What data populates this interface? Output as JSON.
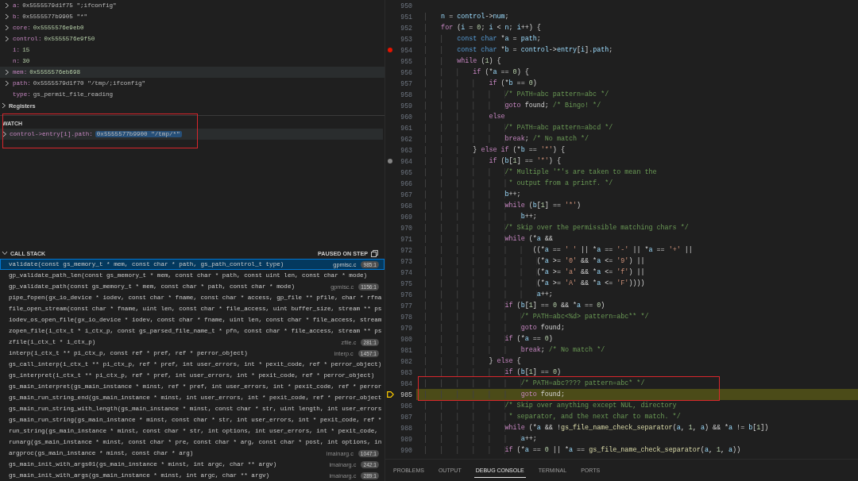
{
  "variables": [
    {
      "label": "a:",
      "value": "0x5555579d1f75 \";ifconfig\"",
      "kind": "text",
      "expandable": true,
      "selected": false
    },
    {
      "label": "b:",
      "value": "0x5555577b9905 \"*\"",
      "kind": "text",
      "expandable": true,
      "selected": false
    },
    {
      "label": "core:",
      "value": "0x5555576e9eb0",
      "kind": "number",
      "expandable": true,
      "selected": false
    },
    {
      "label": "control:",
      "value": "0x5555576e9f50",
      "kind": "number",
      "expandable": true,
      "selected": false
    },
    {
      "label": "i:",
      "value": "15",
      "kind": "number",
      "expandable": false,
      "selected": false
    },
    {
      "label": "n:",
      "value": "30",
      "kind": "number",
      "expandable": false,
      "selected": false
    },
    {
      "label": "mem:",
      "value": "0x5555576eb698",
      "kind": "number",
      "expandable": true,
      "selected": true
    },
    {
      "label": "path:",
      "value": "0x5555579d1f70 \"/tmp/;ifconfig\"",
      "kind": "text",
      "expandable": true,
      "selected": false
    },
    {
      "label": "type:",
      "value": "gs_permit_file_reading",
      "kind": "text",
      "expandable": false,
      "selected": false
    }
  ],
  "registers": {
    "label": "Registers",
    "expanded": false
  },
  "watch": {
    "title": "WATCH",
    "items": [
      {
        "expression": "control->entry[i].path:",
        "value": "0x5555577b9900 \"/tmp/*\"",
        "selected": true
      }
    ]
  },
  "call_stack": {
    "title": "CALL STACK",
    "status": "PAUSED ON STEP",
    "frames": [
      {
        "function": "validate(const gs_memory_t * mem, const char * path, gs_path_control_t type)",
        "file": "gpmisc.c",
        "position": "985:1",
        "selected": true
      },
      {
        "function": "gp_validate_path_len(const gs_memory_t * mem, const char * path, const uint len, const char * mode)",
        "selected": false
      },
      {
        "function": "gp_validate_path(const gs_memory_t * mem, const char * path, const char * mode)",
        "file": "gpmisc.c",
        "position": "1156:1",
        "selected": false
      },
      {
        "function": "pipe_fopen(gx_io_device * iodev, const char * fname, const char * access, gp_file ** pfile, char * rfna",
        "selected": false
      },
      {
        "function": "file_open_stream(const char * fname, uint len, const char * file_access, uint buffer_size, stream ** ps",
        "selected": false
      },
      {
        "function": "iodev_os_open_file(gx_io_device * iodev, const char * fname, uint len, const char * file_access, stream",
        "selected": false
      },
      {
        "function": "zopen_file(i_ctx_t * i_ctx_p, const gs_parsed_file_name_t * pfn, const char * file_access, stream ** ps",
        "selected": false
      },
      {
        "function": "zfile(i_ctx_t * i_ctx_p)",
        "file": "zfile.c",
        "position": "281:1",
        "selected": false
      },
      {
        "function": "interp(i_ctx_t ** pi_ctx_p, const ref * pref, ref * perror_object)",
        "file": "interp.c",
        "position": "1457:1",
        "selected": false
      },
      {
        "function": "gs_call_interp(i_ctx_t ** pi_ctx_p, ref * pref, int user_errors, int * pexit_code, ref * perror_object)",
        "selected": false
      },
      {
        "function": "gs_interpret(i_ctx_t ** pi_ctx_p, ref * pref, int user_errors, int * pexit_code, ref * perror_object)",
        "selected": false
      },
      {
        "function": "gs_main_interpret(gs_main_instance * minst, ref * pref, int user_errors, int * pexit_code, ref * perror",
        "selected": false
      },
      {
        "function": "gs_main_run_string_end(gs_main_instance * minst, int user_errors, int * pexit_code, ref * perror_object",
        "selected": false
      },
      {
        "function": "gs_main_run_string_with_length(gs_main_instance * minst, const char * str, uint length, int user_errors",
        "selected": false
      },
      {
        "function": "gs_main_run_string(gs_main_instance * minst, const char * str, int user_errors, int * pexit_code, ref *",
        "selected": false
      },
      {
        "function": "run_string(gs_main_instance * minst, const char * str, int options, int user_errors, int * pexit_code,",
        "selected": false
      },
      {
        "function": "runarg(gs_main_instance * minst, const char * pre, const char * arg, const char * post, int options, in",
        "selected": false
      },
      {
        "function": "argproc(gs_main_instance * minst, const char * arg)",
        "file": "imainarg.c",
        "position": "1047:1",
        "selected": false
      },
      {
        "function": "gs_main_init_with_args01(gs_main_instance * minst, int argc, char ** argv)",
        "file": "imainarg.c",
        "position": "242:1",
        "selected": false
      },
      {
        "function": "gs_main_init_with_args(gs_main_instance * minst, int argc, char ** argv)",
        "file": "imainarg.c",
        "position": "289:1",
        "selected": false
      }
    ]
  },
  "editor": {
    "lines": [
      {
        "number": "950",
        "breakpoint": false,
        "current": false
      },
      {
        "number": "951",
        "breakpoint": false,
        "current": false,
        "tokens": [
          {
            "kind": "variable",
            "text": "    n"
          },
          {
            "kind": "plain",
            "text": " = "
          },
          {
            "kind": "variable",
            "text": "control"
          },
          {
            "kind": "plain",
            "text": "->"
          },
          {
            "kind": "variable",
            "text": "num"
          },
          {
            "kind": "plain",
            "text": ";"
          }
        ]
      },
      {
        "number": "952",
        "breakpoint": false,
        "current": false,
        "tokens": [
          {
            "kind": "keyword",
            "text": "    for"
          },
          {
            "kind": "plain",
            "text": " ("
          },
          {
            "kind": "variable",
            "text": "i"
          },
          {
            "kind": "plain",
            "text": " = "
          },
          {
            "kind": "number",
            "text": "0"
          },
          {
            "kind": "plain",
            "text": "; "
          },
          {
            "kind": "variable",
            "text": "i"
          },
          {
            "kind": "plain",
            "text": " < "
          },
          {
            "kind": "variable",
            "text": "n"
          },
          {
            "kind": "plain",
            "text": "; "
          },
          {
            "kind": "variable",
            "text": "i"
          },
          {
            "kind": "plain",
            "text": "++) {"
          }
        ]
      },
      {
        "number": "953",
        "breakpoint": false,
        "current": false,
        "tokens": [
          {
            "kind": "type",
            "text": "        const char"
          },
          {
            "kind": "plain",
            "text": " *"
          },
          {
            "kind": "variable",
            "text": "a"
          },
          {
            "kind": "plain",
            "text": " = "
          },
          {
            "kind": "variable",
            "text": "path"
          },
          {
            "kind": "plain",
            "text": ";"
          }
        ]
      },
      {
        "number": "954",
        "breakpoint": true,
        "breakpoint_enabled": true,
        "current": false,
        "tokens": [
          {
            "kind": "type",
            "text": "        const char"
          },
          {
            "kind": "plain",
            "text": " *"
          },
          {
            "kind": "variable",
            "text": "b"
          },
          {
            "kind": "plain",
            "text": " = "
          },
          {
            "kind": "variable",
            "text": "control"
          },
          {
            "kind": "plain",
            "text": "->"
          },
          {
            "kind": "variable",
            "text": "entry"
          },
          {
            "kind": "plain",
            "text": "["
          },
          {
            "kind": "variable",
            "text": "i"
          },
          {
            "kind": "plain",
            "text": "]."
          },
          {
            "kind": "variable",
            "text": "path"
          },
          {
            "kind": "plain",
            "text": ";"
          }
        ]
      },
      {
        "number": "955",
        "breakpoint": false,
        "current": false,
        "tokens": [
          {
            "kind": "keyword",
            "text": "        while"
          },
          {
            "kind": "plain",
            "text": " ("
          },
          {
            "kind": "number",
            "text": "1"
          },
          {
            "kind": "plain",
            "text": ") {"
          }
        ]
      },
      {
        "number": "956",
        "breakpoint": false,
        "current": false,
        "tokens": [
          {
            "kind": "keyword",
            "text": "            if"
          },
          {
            "kind": "plain",
            "text": " (*"
          },
          {
            "kind": "variable",
            "text": "a"
          },
          {
            "kind": "plain",
            "text": " == "
          },
          {
            "kind": "number",
            "text": "0"
          },
          {
            "kind": "plain",
            "text": ") {"
          }
        ]
      },
      {
        "number": "957",
        "breakpoint": false,
        "current": false,
        "tokens": [
          {
            "kind": "keyword",
            "text": "                if"
          },
          {
            "kind": "plain",
            "text": " (*"
          },
          {
            "kind": "variable",
            "text": "b"
          },
          {
            "kind": "plain",
            "text": " == "
          },
          {
            "kind": "number",
            "text": "0"
          },
          {
            "kind": "plain",
            "text": ")"
          }
        ]
      },
      {
        "number": "958",
        "breakpoint": false,
        "current": false,
        "tokens": [
          {
            "kind": "comment",
            "text": "                    /* PATH=abc pattern=abc */"
          }
        ]
      },
      {
        "number": "959",
        "breakpoint": false,
        "current": false,
        "tokens": [
          {
            "kind": "keyword",
            "text": "                    goto"
          },
          {
            "kind": "plain",
            "text": " found; "
          },
          {
            "kind": "comment",
            "text": "/* Bingo! */"
          }
        ]
      },
      {
        "number": "960",
        "breakpoint": false,
        "current": false,
        "tokens": [
          {
            "kind": "keyword",
            "text": "                else"
          }
        ]
      },
      {
        "number": "961",
        "breakpoint": false,
        "current": false,
        "tokens": [
          {
            "kind": "comment",
            "text": "                    /* PATH=abc pattern=abcd */"
          }
        ]
      },
      {
        "number": "962",
        "breakpoint": false,
        "current": false,
        "tokens": [
          {
            "kind": "keyword",
            "text": "                    break"
          },
          {
            "kind": "plain",
            "text": "; "
          },
          {
            "kind": "comment",
            "text": "/* No match */"
          }
        ]
      },
      {
        "number": "963",
        "breakpoint": false,
        "current": false,
        "tokens": [
          {
            "kind": "plain",
            "text": "            } "
          },
          {
            "kind": "keyword",
            "text": "else if"
          },
          {
            "kind": "plain",
            "text": " (*"
          },
          {
            "kind": "variable",
            "text": "b"
          },
          {
            "kind": "plain",
            "text": " == "
          },
          {
            "kind": "string",
            "text": "'*'"
          },
          {
            "kind": "plain",
            "text": ") {"
          }
        ]
      },
      {
        "number": "964",
        "breakpoint": true,
        "breakpoint_enabled": false,
        "current": false,
        "tokens": [
          {
            "kind": "keyword",
            "text": "                if"
          },
          {
            "kind": "plain",
            "text": " ("
          },
          {
            "kind": "variable",
            "text": "b"
          },
          {
            "kind": "plain",
            "text": "["
          },
          {
            "kind": "number",
            "text": "1"
          },
          {
            "kind": "plain",
            "text": "] == "
          },
          {
            "kind": "string",
            "text": "'*'"
          },
          {
            "kind": "plain",
            "text": ") {"
          }
        ]
      },
      {
        "number": "965",
        "breakpoint": false,
        "current": false,
        "tokens": [
          {
            "kind": "comment",
            "text": "                    /* Multiple '*'s are taken to mean the"
          }
        ]
      },
      {
        "number": "966",
        "breakpoint": false,
        "current": false,
        "tokens": [
          {
            "kind": "comment",
            "text": "                     * output from a printf. */"
          }
        ]
      },
      {
        "number": "967",
        "breakpoint": false,
        "current": false,
        "tokens": [
          {
            "kind": "variable",
            "text": "                    b"
          },
          {
            "kind": "plain",
            "text": "++;"
          }
        ]
      },
      {
        "number": "968",
        "breakpoint": false,
        "current": false,
        "tokens": [
          {
            "kind": "keyword",
            "text": "                    while"
          },
          {
            "kind": "plain",
            "text": " ("
          },
          {
            "kind": "variable",
            "text": "b"
          },
          {
            "kind": "plain",
            "text": "["
          },
          {
            "kind": "number",
            "text": "1"
          },
          {
            "kind": "plain",
            "text": "] == "
          },
          {
            "kind": "string",
            "text": "'*'"
          },
          {
            "kind": "plain",
            "text": ")"
          }
        ]
      },
      {
        "number": "969",
        "breakpoint": false,
        "current": false,
        "tokens": [
          {
            "kind": "variable",
            "text": "                        b"
          },
          {
            "kind": "plain",
            "text": "++;"
          }
        ]
      },
      {
        "number": "970",
        "breakpoint": false,
        "current": false,
        "tokens": [
          {
            "kind": "comment",
            "text": "                    /* Skip over the permissible matching chars */"
          }
        ]
      },
      {
        "number": "971",
        "breakpoint": false,
        "current": false,
        "tokens": [
          {
            "kind": "keyword",
            "text": "                    while"
          },
          {
            "kind": "plain",
            "text": " (*"
          },
          {
            "kind": "variable",
            "text": "a"
          },
          {
            "kind": "plain",
            "text": " &&"
          }
        ]
      },
      {
        "number": "972",
        "breakpoint": false,
        "current": false,
        "tokens": [
          {
            "kind": "plain",
            "text": "                           ((*"
          },
          {
            "kind": "variable",
            "text": "a"
          },
          {
            "kind": "plain",
            "text": " == "
          },
          {
            "kind": "string",
            "text": "' '"
          },
          {
            "kind": "plain",
            "text": " || *"
          },
          {
            "kind": "variable",
            "text": "a"
          },
          {
            "kind": "plain",
            "text": " == "
          },
          {
            "kind": "string",
            "text": "'-'"
          },
          {
            "kind": "plain",
            "text": " || *"
          },
          {
            "kind": "variable",
            "text": "a"
          },
          {
            "kind": "plain",
            "text": " == "
          },
          {
            "kind": "string",
            "text": "'+'"
          },
          {
            "kind": "plain",
            "text": " ||"
          }
        ]
      },
      {
        "number": "973",
        "breakpoint": false,
        "current": false,
        "tokens": [
          {
            "kind": "plain",
            "text": "                            (*"
          },
          {
            "kind": "variable",
            "text": "a"
          },
          {
            "kind": "plain",
            "text": " >= "
          },
          {
            "kind": "string",
            "text": "'0'"
          },
          {
            "kind": "plain",
            "text": " && *"
          },
          {
            "kind": "variable",
            "text": "a"
          },
          {
            "kind": "plain",
            "text": " <= "
          },
          {
            "kind": "string",
            "text": "'9'"
          },
          {
            "kind": "plain",
            "text": ") ||"
          }
        ]
      },
      {
        "number": "974",
        "breakpoint": false,
        "current": false,
        "tokens": [
          {
            "kind": "plain",
            "text": "                            (*"
          },
          {
            "kind": "variable",
            "text": "a"
          },
          {
            "kind": "plain",
            "text": " >= "
          },
          {
            "kind": "string",
            "text": "'a'"
          },
          {
            "kind": "plain",
            "text": " && *"
          },
          {
            "kind": "variable",
            "text": "a"
          },
          {
            "kind": "plain",
            "text": " <= "
          },
          {
            "kind": "string",
            "text": "'f'"
          },
          {
            "kind": "plain",
            "text": ") ||"
          }
        ]
      },
      {
        "number": "975",
        "breakpoint": false,
        "current": false,
        "tokens": [
          {
            "kind": "plain",
            "text": "                            (*"
          },
          {
            "kind": "variable",
            "text": "a"
          },
          {
            "kind": "plain",
            "text": " >= "
          },
          {
            "kind": "string",
            "text": "'A'"
          },
          {
            "kind": "plain",
            "text": " && *"
          },
          {
            "kind": "variable",
            "text": "a"
          },
          {
            "kind": "plain",
            "text": " <= "
          },
          {
            "kind": "string",
            "text": "'F'"
          },
          {
            "kind": "plain",
            "text": "))))"
          }
        ]
      },
      {
        "number": "976",
        "breakpoint": false,
        "current": false,
        "tokens": [
          {
            "kind": "variable",
            "text": "                            a"
          },
          {
            "kind": "plain",
            "text": "++;"
          }
        ]
      },
      {
        "number": "977",
        "breakpoint": false,
        "current": false,
        "tokens": [
          {
            "kind": "keyword",
            "text": "                    if"
          },
          {
            "kind": "plain",
            "text": " ("
          },
          {
            "kind": "variable",
            "text": "b"
          },
          {
            "kind": "plain",
            "text": "["
          },
          {
            "kind": "number",
            "text": "1"
          },
          {
            "kind": "plain",
            "text": "] == "
          },
          {
            "kind": "number",
            "text": "0"
          },
          {
            "kind": "plain",
            "text": " && *"
          },
          {
            "kind": "variable",
            "text": "a"
          },
          {
            "kind": "plain",
            "text": " == "
          },
          {
            "kind": "number",
            "text": "0"
          },
          {
            "kind": "plain",
            "text": ")"
          }
        ]
      },
      {
        "number": "978",
        "breakpoint": false,
        "current": false,
        "tokens": [
          {
            "kind": "comment",
            "text": "                        /* PATH=abc<%d> pattern=abc** */"
          }
        ]
      },
      {
        "number": "979",
        "breakpoint": false,
        "current": false,
        "tokens": [
          {
            "kind": "keyword",
            "text": "                        goto"
          },
          {
            "kind": "plain",
            "text": " found;"
          }
        ]
      },
      {
        "number": "980",
        "breakpoint": false,
        "current": false,
        "tokens": [
          {
            "kind": "keyword",
            "text": "                    if"
          },
          {
            "kind": "plain",
            "text": " (*"
          },
          {
            "kind": "variable",
            "text": "a"
          },
          {
            "kind": "plain",
            "text": " == "
          },
          {
            "kind": "number",
            "text": "0"
          },
          {
            "kind": "plain",
            "text": ")"
          }
        ]
      },
      {
        "number": "981",
        "breakpoint": false,
        "current": false,
        "tokens": [
          {
            "kind": "keyword",
            "text": "                        break"
          },
          {
            "kind": "plain",
            "text": "; "
          },
          {
            "kind": "comment",
            "text": "/* No match */"
          }
        ]
      },
      {
        "number": "982",
        "breakpoint": false,
        "current": false,
        "tokens": [
          {
            "kind": "plain",
            "text": "                } "
          },
          {
            "kind": "keyword",
            "text": "else"
          },
          {
            "kind": "plain",
            "text": " {"
          }
        ]
      },
      {
        "number": "983",
        "breakpoint": false,
        "current": false,
        "tokens": [
          {
            "kind": "keyword",
            "text": "                    if"
          },
          {
            "kind": "plain",
            "text": " ("
          },
          {
            "kind": "variable",
            "text": "b"
          },
          {
            "kind": "plain",
            "text": "["
          },
          {
            "kind": "number",
            "text": "1"
          },
          {
            "kind": "plain",
            "text": "] == "
          },
          {
            "kind": "number",
            "text": "0"
          },
          {
            "kind": "plain",
            "text": ")"
          }
        ]
      },
      {
        "number": "984",
        "breakpoint": false,
        "current": false,
        "tokens": [
          {
            "kind": "comment",
            "text": "                        /* PATH=abc???? pattern=abc* */"
          }
        ]
      },
      {
        "number": "985",
        "breakpoint": false,
        "current": true,
        "tokens": [
          {
            "kind": "keyword",
            "text": "                        goto"
          },
          {
            "kind": "plain",
            "text": " found;"
          }
        ]
      },
      {
        "number": "986",
        "breakpoint": false,
        "current": false,
        "tokens": [
          {
            "kind": "comment",
            "text": "                    /* Skip over anything except NUL, directory"
          }
        ]
      },
      {
        "number": "987",
        "breakpoint": false,
        "current": false,
        "tokens": [
          {
            "kind": "comment",
            "text": "                     * separator, and the next char to match. */"
          }
        ]
      },
      {
        "number": "988",
        "breakpoint": false,
        "current": false,
        "tokens": [
          {
            "kind": "keyword",
            "text": "                    while"
          },
          {
            "kind": "plain",
            "text": " (*"
          },
          {
            "kind": "variable",
            "text": "a"
          },
          {
            "kind": "plain",
            "text": " && !"
          },
          {
            "kind": "function",
            "text": "gs_file_name_check_separator"
          },
          {
            "kind": "plain",
            "text": "("
          },
          {
            "kind": "variable",
            "text": "a"
          },
          {
            "kind": "plain",
            "text": ", "
          },
          {
            "kind": "number",
            "text": "1"
          },
          {
            "kind": "plain",
            "text": ", "
          },
          {
            "kind": "variable",
            "text": "a"
          },
          {
            "kind": "plain",
            "text": ") && *"
          },
          {
            "kind": "variable",
            "text": "a"
          },
          {
            "kind": "plain",
            "text": " != "
          },
          {
            "kind": "variable",
            "text": "b"
          },
          {
            "kind": "plain",
            "text": "["
          },
          {
            "kind": "number",
            "text": "1"
          },
          {
            "kind": "plain",
            "text": "])"
          }
        ]
      },
      {
        "number": "989",
        "breakpoint": false,
        "current": false,
        "tokens": [
          {
            "kind": "variable",
            "text": "                        a"
          },
          {
            "kind": "plain",
            "text": "++;"
          }
        ]
      },
      {
        "number": "990",
        "breakpoint": false,
        "current": false,
        "tokens": [
          {
            "kind": "keyword",
            "text": "                    if"
          },
          {
            "kind": "plain",
            "text": " (*"
          },
          {
            "kind": "variable",
            "text": "a"
          },
          {
            "kind": "plain",
            "text": " == "
          },
          {
            "kind": "number",
            "text": "0"
          },
          {
            "kind": "plain",
            "text": " || *"
          },
          {
            "kind": "variable",
            "text": "a"
          },
          {
            "kind": "plain",
            "text": " == "
          },
          {
            "kind": "function",
            "text": "gs_file_name_check_separator"
          },
          {
            "kind": "plain",
            "text": "("
          },
          {
            "kind": "variable",
            "text": "a"
          },
          {
            "kind": "plain",
            "text": ", "
          },
          {
            "kind": "number",
            "text": "1"
          },
          {
            "kind": "plain",
            "text": ", "
          },
          {
            "kind": "variable",
            "text": "a"
          },
          {
            "kind": "plain",
            "text": "))"
          }
        ]
      }
    ]
  },
  "panel_tabs": [
    {
      "label": "PROBLEMS",
      "selected": false
    },
    {
      "label": "OUTPUT",
      "selected": false
    },
    {
      "label": "DEBUG CONSOLE",
      "selected": true
    },
    {
      "label": "TERMINAL",
      "selected": false
    },
    {
      "label": "PORTS",
      "selected": false
    }
  ]
}
